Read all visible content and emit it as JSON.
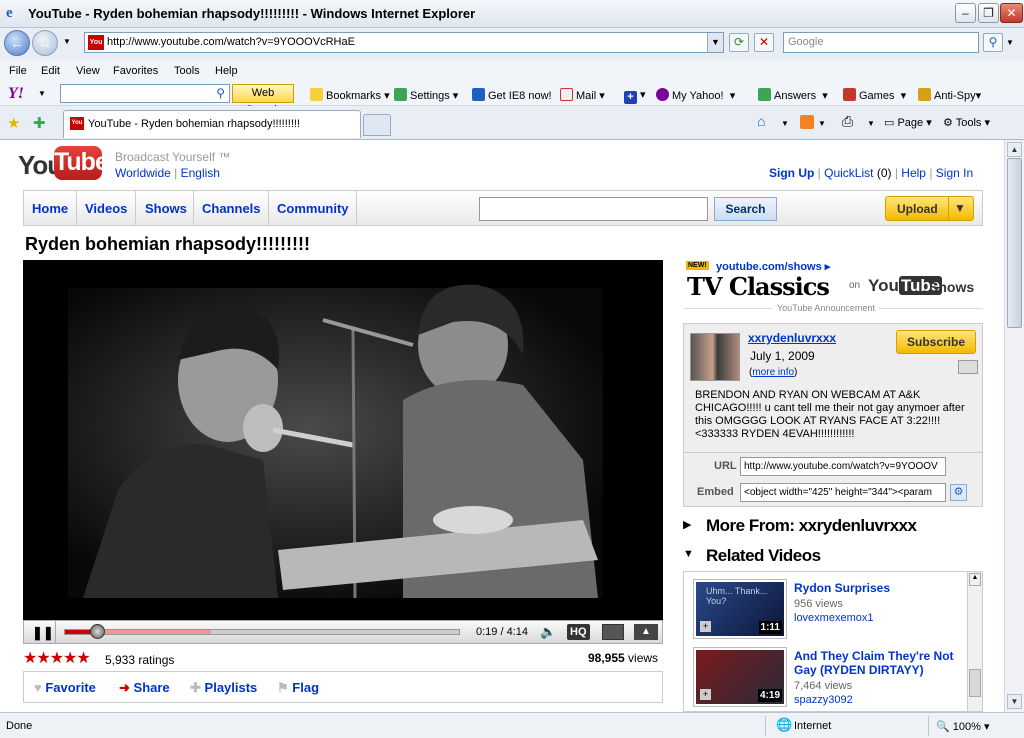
{
  "window": {
    "title": "YouTube - Ryden bohemian rhapsody!!!!!!!!! - Windows Internet Explorer"
  },
  "address": {
    "url": "http://www.youtube.com/watch?v=9YOOOVcRHaE",
    "search_placeholder": "Google"
  },
  "menu": [
    "File",
    "Edit",
    "View",
    "Favorites",
    "Tools",
    "Help"
  ],
  "yahoo_toolbar": {
    "web_search": "Web Search",
    "bookmarks": "Bookmarks",
    "settings": "Settings",
    "get_ie8": "Get IE8 now!",
    "mail": "Mail",
    "my_yahoo": "My Yahoo!",
    "answers": "Answers",
    "games": "Games",
    "antispy": "Anti-Spy"
  },
  "tab": {
    "label": "YouTube - Ryden bohemian rhapsody!!!!!!!!!"
  },
  "commandbar": {
    "page": "Page",
    "tools": "Tools"
  },
  "yt": {
    "logo_you": "You",
    "logo_tube": "Tube",
    "tagline": "Broadcast Yourself ™",
    "worldwide": "Worldwide",
    "language": "English",
    "signup": "Sign Up",
    "quicklist": "QuickList",
    "quicklist_count": "(0)",
    "help": "Help",
    "signin": "Sign In",
    "nav": [
      "Home",
      "Videos",
      "Shows",
      "Channels",
      "Community"
    ],
    "search_button": "Search",
    "upload": "Upload"
  },
  "video": {
    "title": "Ryden bohemian rhapsody!!!!!!!!!",
    "progress_fraction": 0.08,
    "buffered_fraction": 0.37,
    "time": "0:19 / 4:14",
    "hq": "HQ",
    "rating_stars": 5,
    "ratings": "5,933 ratings",
    "views_count": "98,955",
    "views_label": "views",
    "actions": [
      "Favorite",
      "Share",
      "Playlists",
      "Flag"
    ]
  },
  "ad": {
    "new_badge": "NEW!",
    "link": "youtube.com/shows ▸",
    "headline": "TV Classics",
    "on": "on",
    "shows": "Shows",
    "announcement": "YouTube Announcement"
  },
  "uploader": {
    "name": "xxrydenluvrxxx",
    "date": "July 1, 2009",
    "more_info": "more info",
    "subscribe": "Subscribe",
    "description": "BRENDON AND RYAN ON WEBCAM AT A&K CHICAGO!!!!!  u cant tell me their not gay anymoer after this OMGGGG LOOK AT RYANS FACE AT 3:22!!!!  <333333 RYDEN 4EVAH!!!!!!!!!!!!",
    "url_label": "URL",
    "url_value": "http://www.youtube.com/watch?v=9YOOOV",
    "embed_label": "Embed",
    "embed_value": "<object width=\"425\" height=\"344\"><param"
  },
  "more_from": "More From: xxrydenluvrxxx",
  "related_heading": "Related Videos",
  "related": [
    {
      "title": "Rydon Surprises",
      "views": "956 views",
      "user": "lovexmexemox1",
      "duration": "1:11",
      "thumb_text": "Uhm... Thank... You?"
    },
    {
      "title": "And They Claim They're Not Gay (RYDEN DIRTAYY)",
      "views": "7,464 views",
      "user": "spazzy3092",
      "duration": "4:19"
    }
  ],
  "status": {
    "left": "Done",
    "zone": "Internet",
    "zoom": "100%"
  },
  "colors": {
    "yt_red": "#cc0000",
    "link_blue": "#0033cc",
    "upload_yellow": "#f5b800"
  }
}
